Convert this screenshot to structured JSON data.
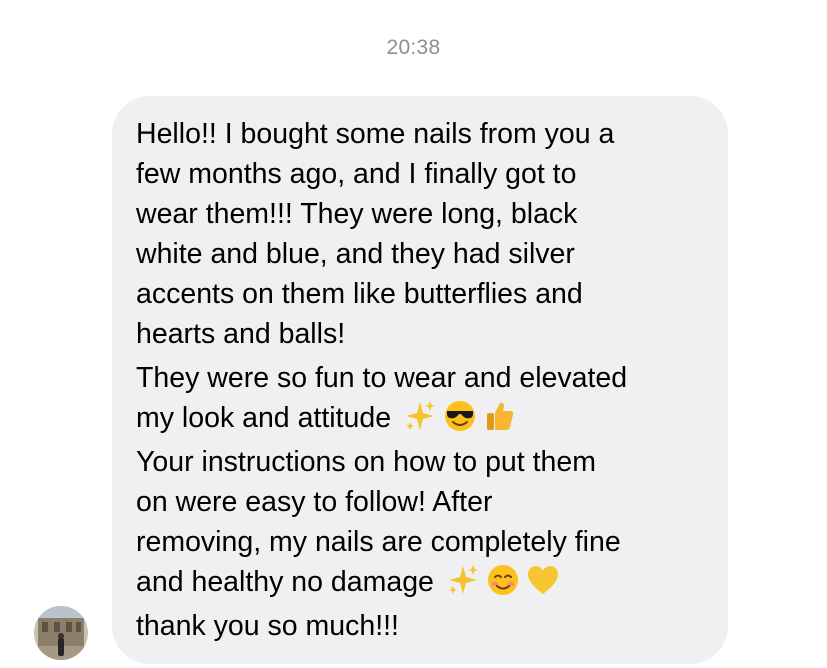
{
  "thread": {
    "timestamp": "20:38"
  },
  "message": {
    "lines": [
      "Hello!! I bought some nails from you a",
      "few months ago, and I finally got to",
      "wear them!!! They were long, black",
      "white and blue, and they had silver",
      "accents on them like butterflies and",
      "hearts and balls!",
      "They were so fun to wear and elevated",
      "my look and attitude",
      "Your instructions on how to put them",
      "on were easy to follow! After",
      "removing, my nails are completely fine",
      "and healthy no damage",
      "thank you so much!!!"
    ],
    "emoji_line_8": [
      "sparkles-icon",
      "smiling-face-with-sunglasses-icon",
      "thumbs-up-icon"
    ],
    "emoji_line_12": [
      "sparkles-icon",
      "smiling-face-icon",
      "yellow-heart-icon"
    ]
  },
  "colors": {
    "bubble_bg": "#f0f0f2",
    "timestamp_text": "#8e8e93",
    "text": "#000000"
  }
}
